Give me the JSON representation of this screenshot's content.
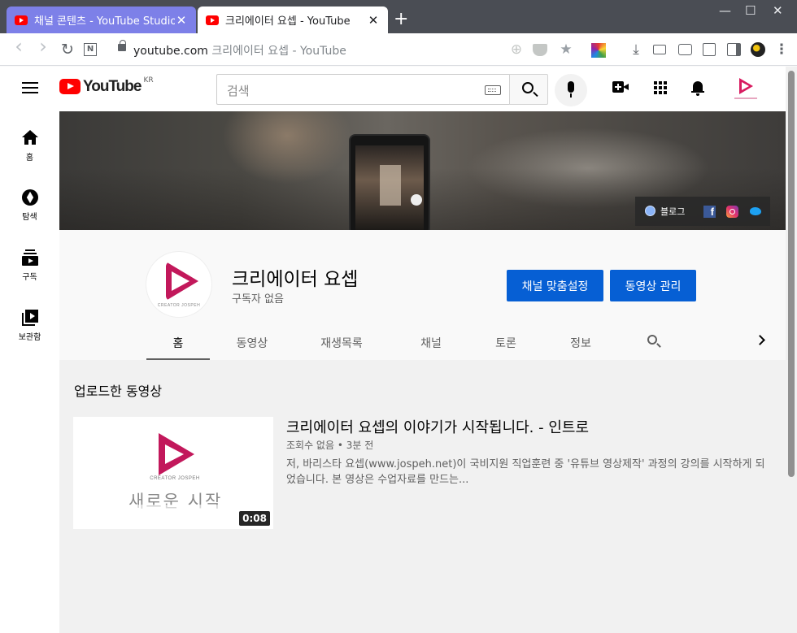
{
  "browser": {
    "tabs": [
      {
        "title": "채널 콘텐츠 - YouTube Studio",
        "active": false
      },
      {
        "title": "크리에이터 요셉 - YouTube",
        "active": true
      }
    ],
    "new_tab": "+",
    "close_glyph": "✕",
    "window_controls": {
      "minimize": "—",
      "maximize": "☐",
      "close": "✕"
    },
    "url_host": "youtube.com",
    "url_title": "크리에이터 요셉 - YouTube",
    "nav_icons": {
      "back": "‹",
      "forward": "›",
      "reload": "↻",
      "n": "N"
    },
    "toolbar_icons": {
      "add": "⊕",
      "star": "★",
      "download": "⤓",
      "menu": "⋮"
    }
  },
  "masthead": {
    "logo_text": "YouTube",
    "logo_region": "KR",
    "search_placeholder": "검색"
  },
  "guide": {
    "items": [
      {
        "label": "홈",
        "icon": "home-icon"
      },
      {
        "label": "탐색",
        "icon": "compass-icon"
      },
      {
        "label": "구독",
        "icon": "subscriptions-icon"
      },
      {
        "label": "보관함",
        "icon": "library-icon"
      }
    ]
  },
  "banner": {
    "link_text": "블로그",
    "fb_letter": "f"
  },
  "channel": {
    "name": "크리에이터 요셉",
    "subscribers": "구독자 없음",
    "avatar_caption": "CREATOR JOSPEH",
    "customize_label": "채널 맞춤설정",
    "manage_label": "동영상 관리",
    "tabs": [
      {
        "label": "홈",
        "active": true
      },
      {
        "label": "동영상",
        "active": false
      },
      {
        "label": "재생목록",
        "active": false
      },
      {
        "label": "채널",
        "active": false
      },
      {
        "label": "토론",
        "active": false
      },
      {
        "label": "정보",
        "active": false
      }
    ]
  },
  "shelf": {
    "title": "업로드한 동영상",
    "video": {
      "title": "크리에이터 요셉의 이야기가 시작됩니다. - 인트로",
      "meta": "조회수 없음 • 3분 전",
      "description": "저, 바리스타 요셉(www.jospeh.net)이 국비지원 직업훈련 중 '유튜브 영상제작' 과정의 강의를 시작하게 되었습니다. 본 영상은 수업자료를 만드는...",
      "duration": "0:08",
      "thumb_text": "새로운 시작",
      "thumb_caption": "CREATOR JOSPEH"
    }
  },
  "colors": {
    "accent_blue": "#065fd4",
    "youtube_red": "#ff0000",
    "brand_pink": "#c2185b"
  }
}
